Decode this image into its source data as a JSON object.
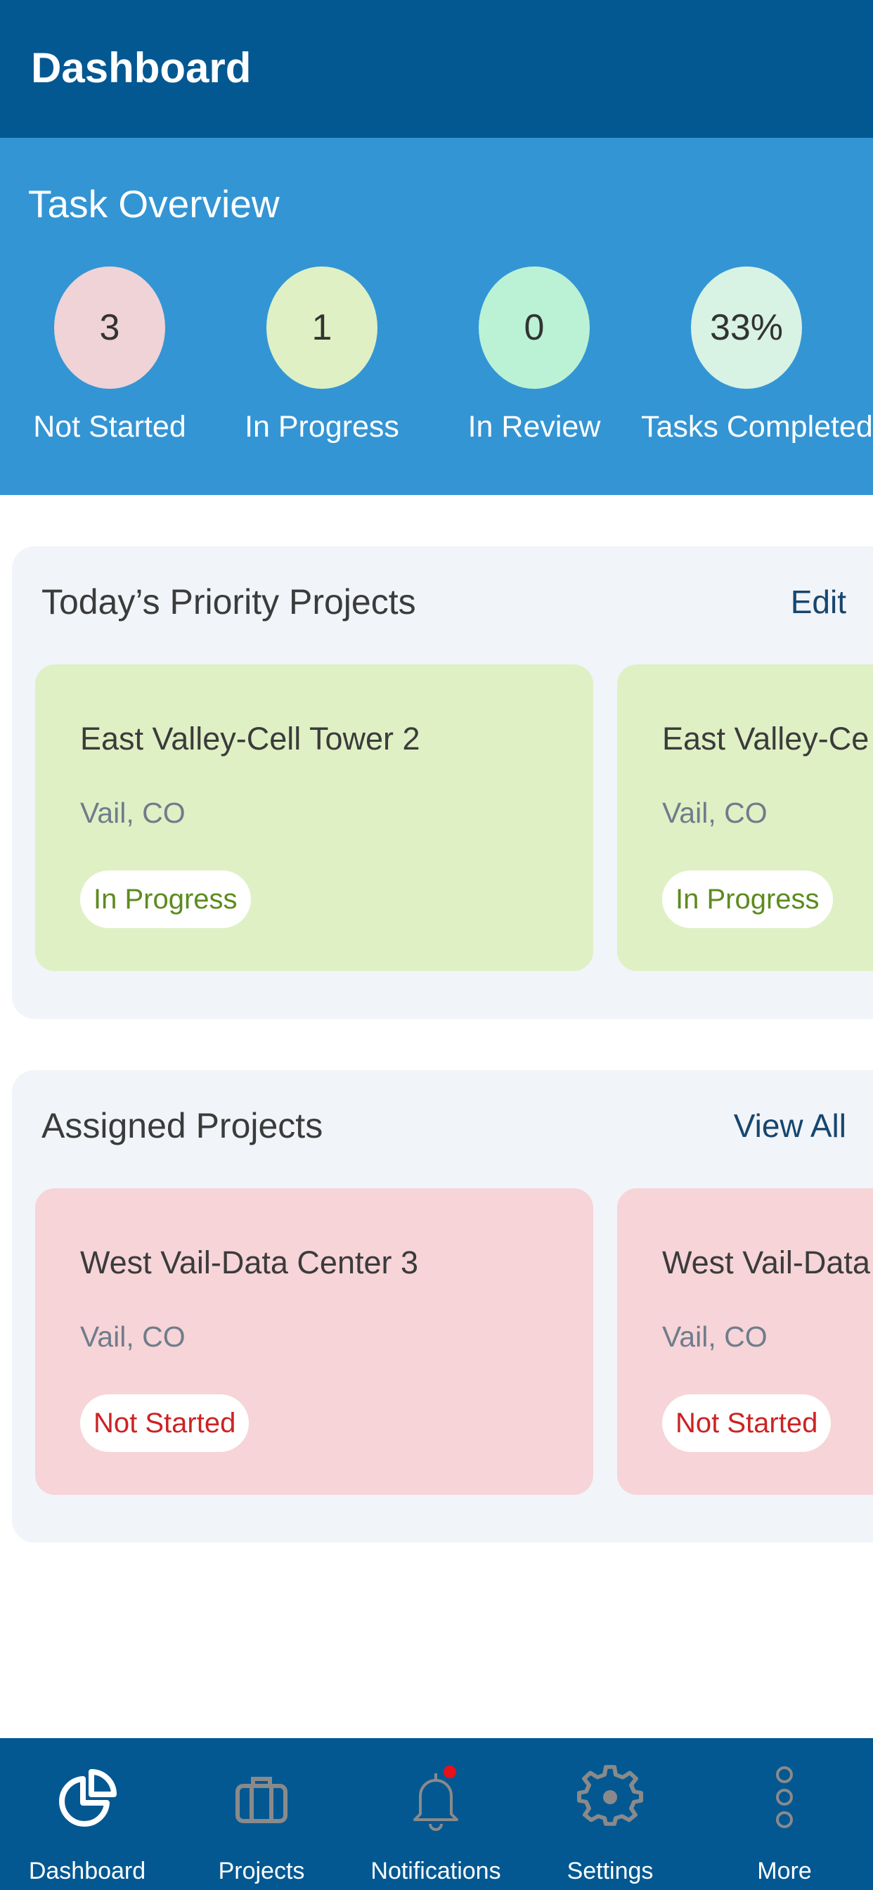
{
  "header": {
    "title": "Dashboard"
  },
  "overview": {
    "title": "Task Overview",
    "stats": [
      {
        "value": "3",
        "label": "Not Started",
        "color": "#efd3d6"
      },
      {
        "value": "1",
        "label": "In Progress",
        "color": "#dff0c5"
      },
      {
        "value": "0",
        "label": "In Review",
        "color": "#bbf2d5"
      },
      {
        "value": "33%",
        "label": "Tasks Completed",
        "color": "#d8f2e4"
      }
    ]
  },
  "priority": {
    "title": "Today’s Priority Projects",
    "action": "Edit",
    "cards": [
      {
        "title": "East Valley-Cell Tower 2",
        "location": "Vail, CO",
        "status": "In Progress"
      },
      {
        "title": "East Valley-Ce",
        "location": "Vail, CO",
        "status": "In Progress"
      }
    ]
  },
  "assigned": {
    "title": "Assigned  Projects",
    "action": "View All",
    "cards": [
      {
        "title": "West Vail-Data Center 3",
        "location": "Vail, CO",
        "status": "Not Started"
      },
      {
        "title": "West Vail-Data",
        "location": "Vail, CO",
        "status": "Not Started"
      }
    ]
  },
  "tabbar": {
    "items": [
      {
        "label": "Dashboard",
        "icon": "pie-chart-icon",
        "active": true
      },
      {
        "label": "Projects",
        "icon": "briefcase-icon",
        "active": false
      },
      {
        "label": "Notifications",
        "icon": "bell-icon",
        "active": false,
        "badge": true
      },
      {
        "label": "Settings",
        "icon": "gear-icon",
        "active": false
      },
      {
        "label": "More",
        "icon": "more-vertical-icon",
        "active": false
      }
    ],
    "colors": {
      "background": "#035892",
      "active_icon": "#ffffff",
      "inactive_icon": "#8a8a8a",
      "badge": "#e8101a"
    }
  }
}
